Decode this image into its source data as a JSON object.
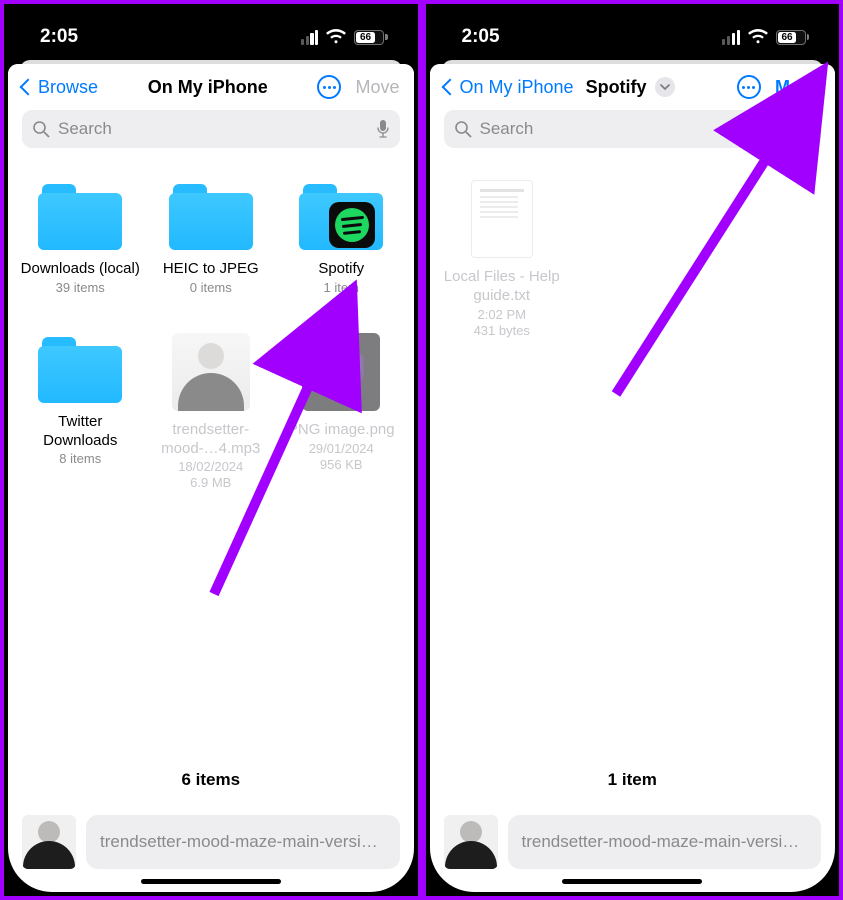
{
  "status": {
    "time": "2:05",
    "battery": "66"
  },
  "left": {
    "back": "Browse",
    "title": "On My iPhone",
    "move": "Move",
    "search_placeholder": "Search",
    "items": [
      {
        "name": "Downloads (local)",
        "sub": "39 items"
      },
      {
        "name": "HEIC to JPEG",
        "sub": "0 items"
      },
      {
        "name": "Spotify",
        "sub": "1 item"
      },
      {
        "name": "Twitter Downloads",
        "sub": "8 items"
      },
      {
        "name": "trendsetter-mood-…4.mp3",
        "date": "18/02/2024",
        "size": "6.9 MB"
      },
      {
        "name": "PNG image.png",
        "date": "29/01/2024",
        "size": "956 KB"
      }
    ],
    "footer": "6 items",
    "clip": "trendsetter-mood-maze-main-versi…"
  },
  "right": {
    "back": "On My iPhone",
    "title": "Spotify",
    "move": "Move",
    "search_placeholder": "Search",
    "file": {
      "name": "Local Files - Help guide.txt",
      "date": "2:02 PM",
      "size": "431 bytes"
    },
    "footer": "1 item",
    "clip": "trendsetter-mood-maze-main-versi…"
  }
}
